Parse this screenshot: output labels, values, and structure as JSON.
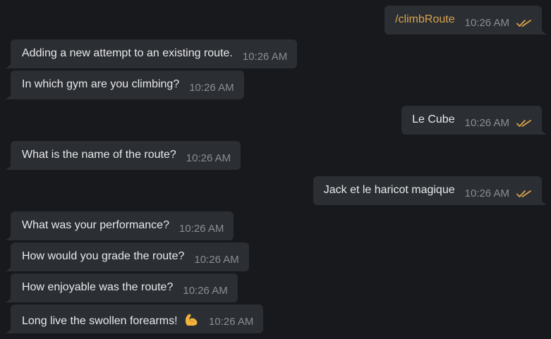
{
  "theme": {
    "background": "#18191d",
    "bubble": "#2b2e33",
    "command_color": "#d8a44c",
    "time_color": "#8a8d91",
    "check_color": "#d8a44c"
  },
  "messages": [
    {
      "id": "m1",
      "direction": "out",
      "text": "/climbRoute",
      "time": "10:26 AM",
      "is_command": true,
      "read": true
    },
    {
      "id": "m2",
      "direction": "in",
      "text": "Adding a new attempt to an existing route.",
      "time": "10:26 AM"
    },
    {
      "id": "m3",
      "direction": "in",
      "text": "In which gym are you climbing?",
      "time": "10:26 AM"
    },
    {
      "id": "m4",
      "direction": "out",
      "text": "Le Cube",
      "time": "10:26 AM",
      "read": true
    },
    {
      "id": "m5",
      "direction": "in",
      "text": "What is the name of the route?",
      "time": "10:26 AM"
    },
    {
      "id": "m6",
      "direction": "out",
      "text": "Jack et le haricot magique",
      "time": "10:26 AM",
      "read": true
    },
    {
      "id": "m7",
      "direction": "in",
      "text": "What was your performance?",
      "time": "10:26 AM"
    },
    {
      "id": "m8",
      "direction": "in",
      "text": "How would you grade the route?",
      "time": "10:26 AM"
    },
    {
      "id": "m9",
      "direction": "in",
      "text": "How enjoyable was the route?",
      "time": "10:26 AM"
    },
    {
      "id": "m10",
      "direction": "in",
      "text": "Long live the swollen forearms!",
      "time": "10:26 AM",
      "emoji": "flexed-biceps-icon"
    }
  ]
}
